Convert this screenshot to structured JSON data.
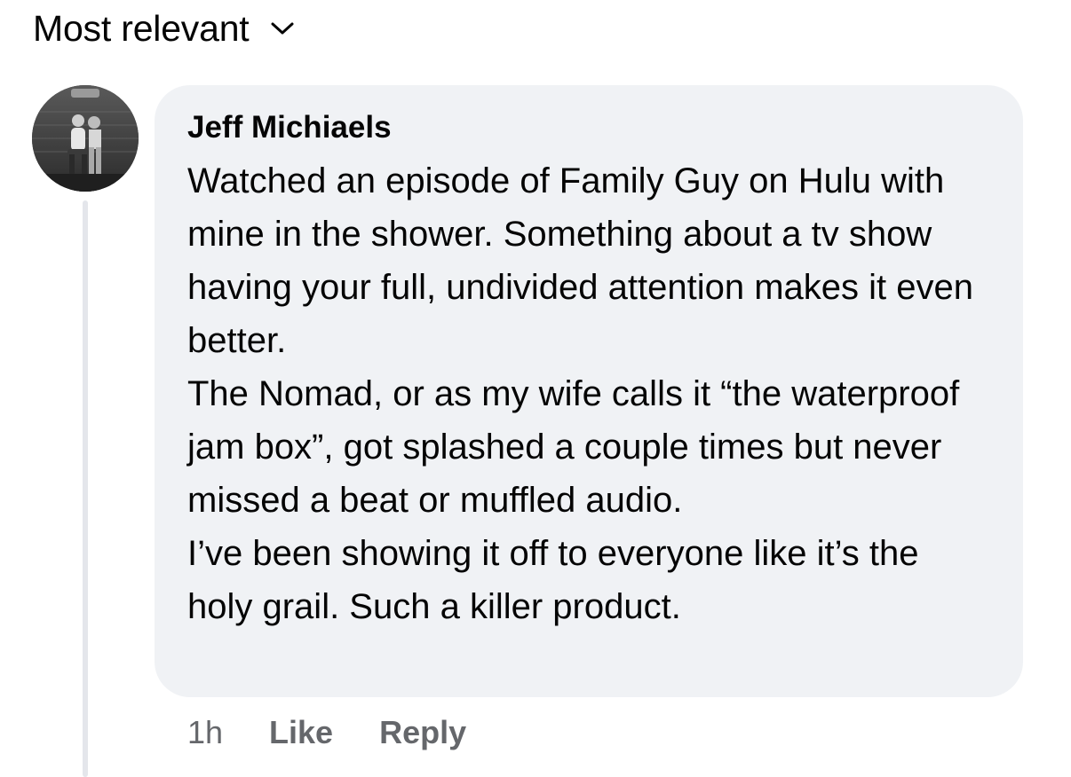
{
  "sort": {
    "label": "Most relevant",
    "icon": "chevron-down-icon"
  },
  "comment": {
    "author": "Jeff Michiaels",
    "paragraphs": [
      "Watched an episode of Family Guy on Hulu with mine in the shower. Something about a tv show having your full, undivided attention makes it even better.",
      "The Nomad, or as my wife calls it “the waterproof jam box”, got splashed a couple times but never missed a beat or muffled audio.",
      "I’ve been showing it off to everyone like it’s the holy grail. Such a killer product."
    ],
    "timestamp": "1h",
    "like_label": "Like",
    "reply_label": "Reply"
  },
  "colors": {
    "bubble": "#f0f2f5",
    "secondary_text": "#65676b",
    "primary_text": "#050505"
  }
}
